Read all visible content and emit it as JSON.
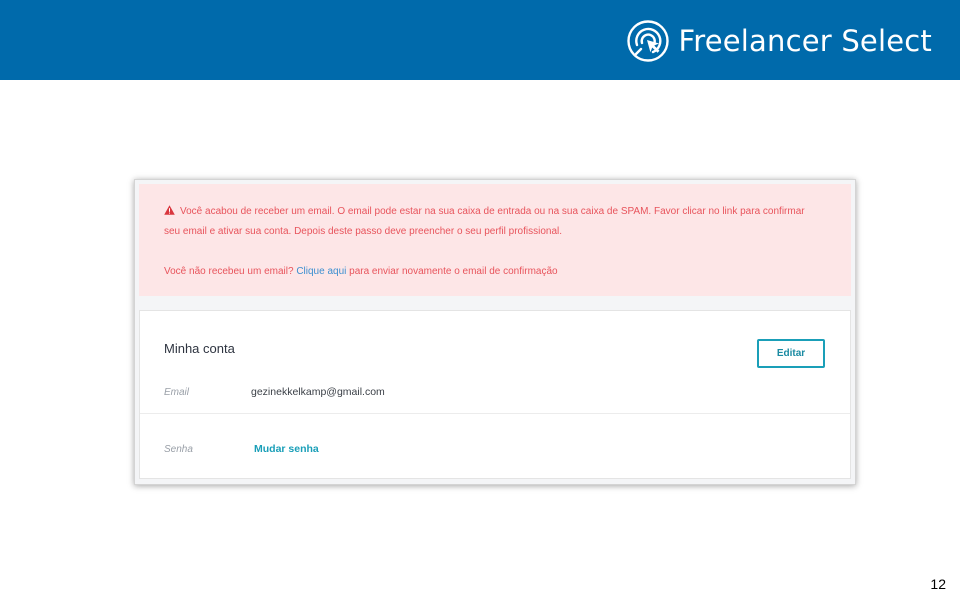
{
  "header": {
    "brand_name": "Freelancer Select",
    "brand_icon": "pointer-rings-icon",
    "background_color": "#006aab"
  },
  "alert": {
    "icon": "warning-triangle-icon",
    "line1": "Você acabou de receber um email. O email pode estar na sua caixa de entrada ou na sua caixa de SPAM. Favor clicar no link para confirmar",
    "line2": "seu email e ativar sua conta. Depois deste passo deve preencher o seu perfil profissional.",
    "resend_prefix": "Você não recebeu um email? ",
    "resend_link": "Clique aqui",
    "resend_suffix": " para enviar novamente o email de confirmação",
    "background_color": "#fde6e7",
    "text_color": "#e8545c"
  },
  "account": {
    "title": "Minha conta",
    "edit_label": "Editar",
    "email_label": "Email",
    "email_value": "gezinekkelkamp@gmail.com",
    "password_label": "Senha",
    "change_password_label": "Mudar senha",
    "accent_color": "#1a9fb8"
  },
  "footer": {
    "page_number": "12"
  }
}
